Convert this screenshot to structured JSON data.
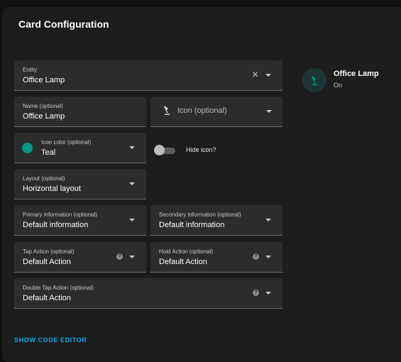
{
  "dialog": {
    "title": "Card Configuration",
    "code_editor_link": "SHOW CODE EDITOR"
  },
  "fields": {
    "entity": {
      "label": "Entity",
      "value": "Office Lamp"
    },
    "name": {
      "label": "Name (optional)",
      "value": "Office Lamp"
    },
    "icon": {
      "label": "Icon (optional)",
      "icon_name": "desk-lamp-icon"
    },
    "icon_color": {
      "label": "Icon color (optional)",
      "value": "Teal",
      "color": "#009688"
    },
    "hide_icon": {
      "label": "Hide icon?",
      "checked": false
    },
    "layout": {
      "label": "Layout (optional)",
      "value": "Horizontal layout"
    },
    "primary_info": {
      "label": "Primary information (optional)",
      "value": "Default information"
    },
    "secondary_info": {
      "label": "Secondary information (optional)",
      "value": "Default information"
    },
    "tap_action": {
      "label": "Tap Action (optional)",
      "value": "Default Action"
    },
    "hold_action": {
      "label": "Hold Action (optional)",
      "value": "Default Action"
    },
    "double_tap_action": {
      "label": "Double Tap Action (optional)",
      "value": "Default Action"
    }
  },
  "preview": {
    "name": "Office Lamp",
    "state": "On",
    "icon_name": "desk-lamp-icon",
    "icon_color": "#009688"
  }
}
